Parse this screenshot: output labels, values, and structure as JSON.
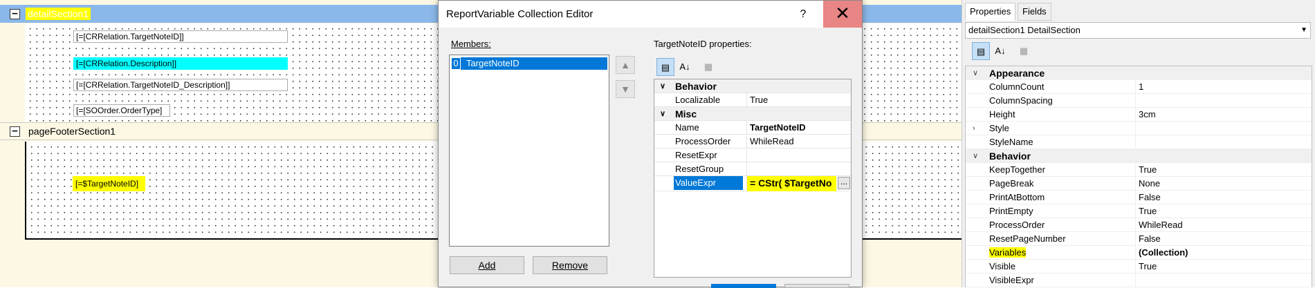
{
  "designer": {
    "detail_section": {
      "toggle": "−",
      "name": "detailSection1"
    },
    "fields": [
      "[=[CRRelation.TargetNoteID]]",
      "[=[CRRelation.Description]]",
      "[=[CRRelation.TargetNoteID_Description]]",
      "[=[SOOrder.OrderType]"
    ],
    "footer_section": {
      "toggle": "−",
      "name": "pageFooterSection1"
    },
    "footer_field": "[=$TargetNoteID]",
    "colors": {
      "section_header": "#8bb8ea",
      "highlight": "#ffff00",
      "selected_field": "#00ffff",
      "background": "#fdf8e4"
    }
  },
  "dialog": {
    "title": "ReportVariable Collection Editor",
    "help_label": "?",
    "close_label": "✕",
    "members_label": "Members:",
    "members": [
      {
        "index": "0",
        "name": "TargetNoteID"
      }
    ],
    "move_up_icon": "▲",
    "move_down_icon": "▼",
    "add_label": "Add",
    "remove_label": "Remove",
    "properties_label": "TargetNoteID properties:",
    "grid": {
      "categories": [
        {
          "name": "Behavior",
          "rows": [
            {
              "name": "Localizable",
              "value": "True"
            }
          ]
        },
        {
          "name": "Misc",
          "rows": [
            {
              "name": "Name",
              "value": "TargetNoteID"
            },
            {
              "name": "ProcessOrder",
              "value": "WhileRead"
            },
            {
              "name": "ResetExpr",
              "value": ""
            },
            {
              "name": "ResetGroup",
              "value": ""
            },
            {
              "name": "ValueExpr",
              "value": "= CStr( $TargetNo"
            }
          ]
        }
      ],
      "ellipsis": "..."
    }
  },
  "properties": {
    "tabs": [
      "Properties",
      "Fields"
    ],
    "object_selector": "detailSection1  DetailSection",
    "categories": [
      {
        "name": "Appearance",
        "rows": [
          {
            "name": "ColumnCount",
            "value": "1"
          },
          {
            "name": "ColumnSpacing",
            "value": ""
          },
          {
            "name": "Height",
            "value": "3cm"
          },
          {
            "name": "Style",
            "value": "",
            "expandable": true
          },
          {
            "name": "StyleName",
            "value": ""
          }
        ]
      },
      {
        "name": "Behavior",
        "rows": [
          {
            "name": "KeepTogether",
            "value": "True"
          },
          {
            "name": "PageBreak",
            "value": "None"
          },
          {
            "name": "PrintAtBottom",
            "value": "False"
          },
          {
            "name": "PrintEmpty",
            "value": "True"
          },
          {
            "name": "ProcessOrder",
            "value": "WhileRead"
          },
          {
            "name": "ResetPageNumber",
            "value": "False"
          },
          {
            "name": "Variables",
            "value": "(Collection)"
          },
          {
            "name": "Visible",
            "value": "True"
          },
          {
            "name": "VisibleExpr",
            "value": ""
          }
        ]
      }
    ]
  }
}
